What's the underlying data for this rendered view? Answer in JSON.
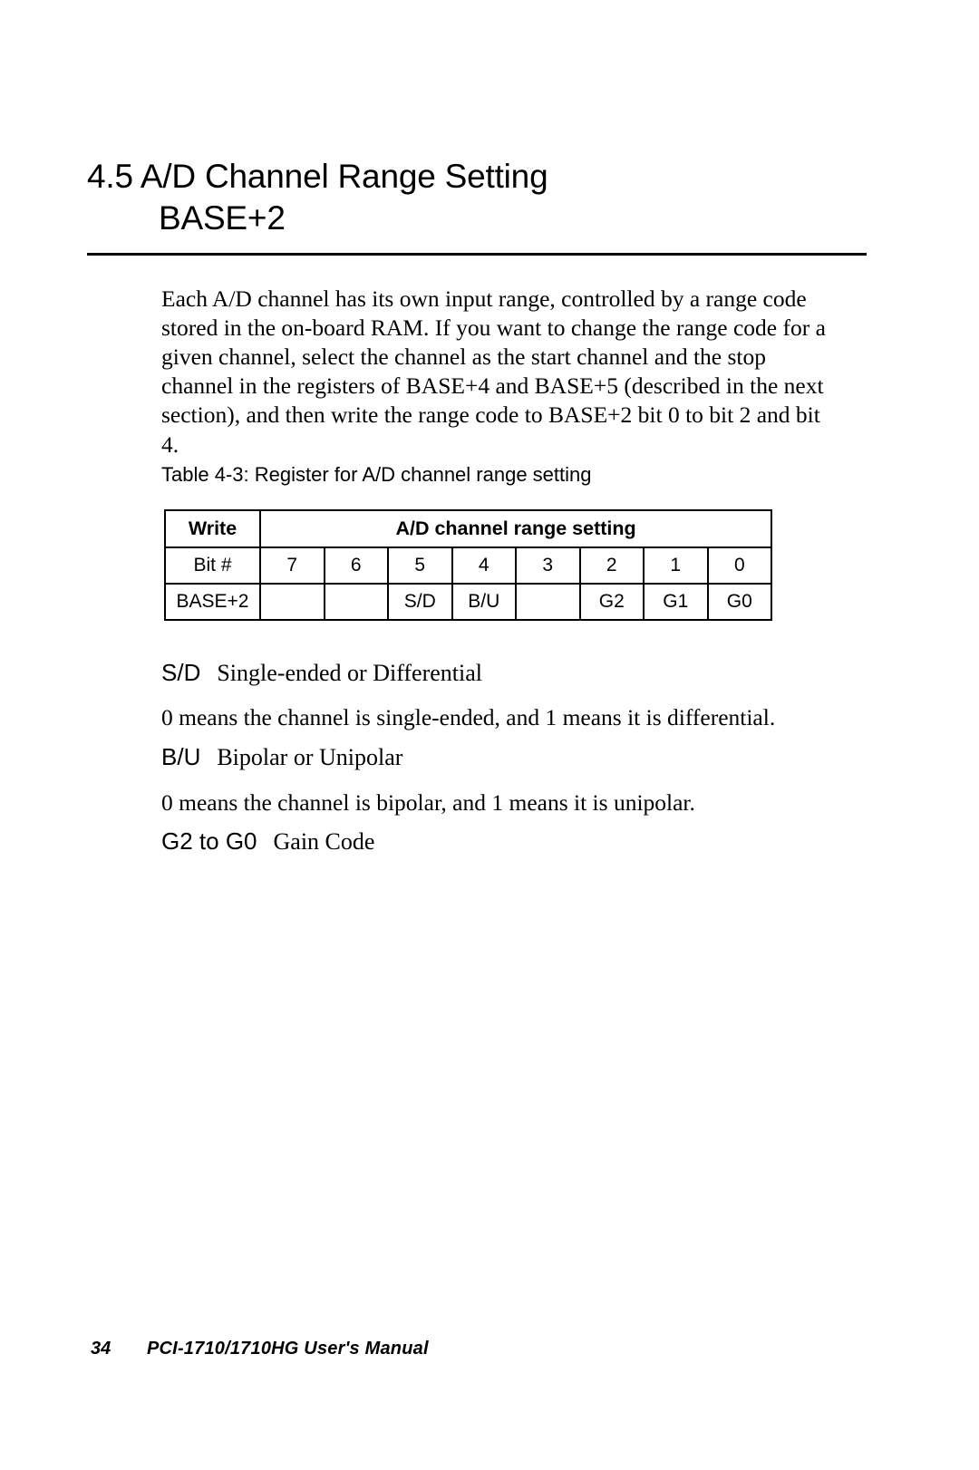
{
  "heading": {
    "line1": "4.5 A/D Channel Range Setting",
    "line2": "BASE+2"
  },
  "intro_paragraph": "Each A/D channel has its own input range, controlled by a range code stored in the on-board RAM.   If you want to change the range code for a given channel, select the channel as the start channel and the stop channel in the registers of BASE+4 and BASE+5 (described in the next section), and then write the range code to BASE+2 bit 0 to bit 2 and bit 4.",
  "table": {
    "caption": "Table 4-3: Register for A/D channel range setting",
    "header": {
      "write_label": "Write",
      "span_label": "A/D channel range setting"
    },
    "rows": [
      {
        "label": "Bit #",
        "cells": [
          "7",
          "6",
          "5",
          "4",
          "3",
          "2",
          "1",
          "0"
        ]
      },
      {
        "label": "BASE+2",
        "cells": [
          "",
          "",
          "S/D",
          "B/U",
          "",
          "G2",
          "G1",
          "G0"
        ]
      }
    ]
  },
  "definitions": [
    {
      "abbr": "S/D",
      "expansion": "Single-ended or Differential",
      "note": "0 means the channel is single-ended, and 1 means it is differential."
    },
    {
      "abbr": "B/U",
      "expansion": "Bipolar or Unipolar",
      "note": "0 means the channel is bipolar, and 1 means it is unipolar."
    },
    {
      "abbr": "G2 to G0",
      "expansion": "Gain Code",
      "note": ""
    }
  ],
  "footer": {
    "page_number": "34",
    "document_title": "PCI-1710/1710HG  User's Manual"
  }
}
